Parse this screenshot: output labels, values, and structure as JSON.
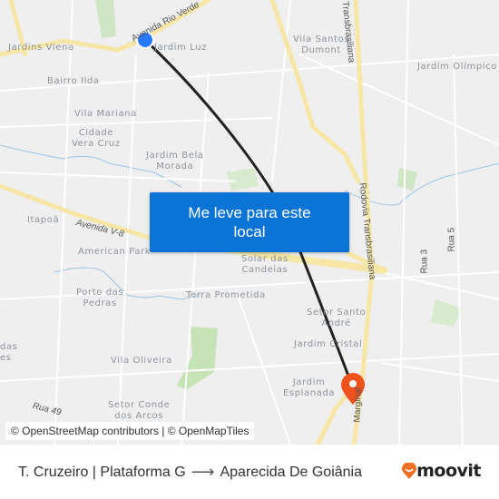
{
  "map": {
    "neighborhoods": [
      {
        "name": "Jardins Viena"
      },
      {
        "name": "Bairro Ilda"
      },
      {
        "name": "Vila Mariana"
      },
      {
        "name": "Cidade\nVera Cruz"
      },
      {
        "name": "Jardim Bela\nMorada"
      },
      {
        "name": "Jardim Luz"
      },
      {
        "name": "Vila Santos\nDumont"
      },
      {
        "name": "Jardim Olímpico"
      },
      {
        "name": "Itapoã"
      },
      {
        "name": "American Park"
      },
      {
        "name": "Solar das\nCandeias"
      },
      {
        "name": "Porto das\nPedras"
      },
      {
        "name": "Terra Prometida"
      },
      {
        "name": "Setor Santo\nAndré"
      },
      {
        "name": "Jardim Cristal"
      },
      {
        "name": "Jardim\nEsplanada"
      },
      {
        "name": "Vila Oliveira"
      },
      {
        "name": "Setor Conde\ndos Arcos"
      },
      {
        "name": "das\nes"
      }
    ],
    "roads": [
      {
        "name": "Avenida Rio Verde"
      },
      {
        "name": "Avenida V-8"
      },
      {
        "name": "Rodovia Transbrasiliana"
      },
      {
        "name": "Transbrasiliana"
      },
      {
        "name": "Rua 3"
      },
      {
        "name": "Rua 5"
      },
      {
        "name": "Rua 49"
      },
      {
        "name": "Marginal"
      }
    ],
    "origin_marker": {
      "label": "origin-stop",
      "color": "#2979ff"
    },
    "destination_marker": {
      "label": "destination",
      "color": "#f0521e"
    },
    "route_color": "#222222",
    "cta_button": "Me leve para este local",
    "attribution": "© OpenStreetMap contributors | © OpenMapTiles"
  },
  "footer": {
    "origin": "T. Cruzeiro | Plataforma G",
    "arrow": "⟶",
    "destination": "Aparecida De Goiânia",
    "brand": "moovit",
    "brand_color": "#f36f21"
  }
}
